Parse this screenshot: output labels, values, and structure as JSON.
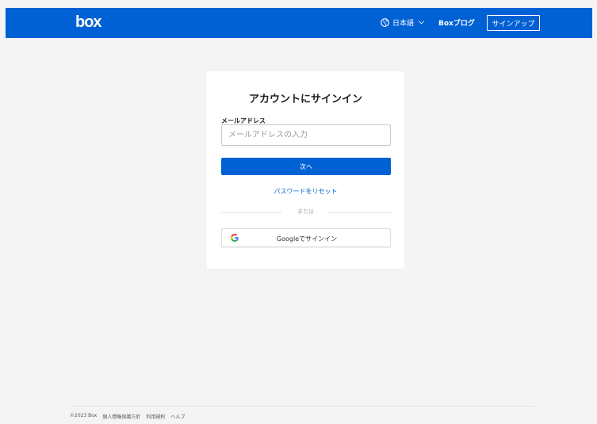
{
  "header": {
    "logo": "box",
    "language": "日本語",
    "blog": "Boxブログ",
    "signup": "サインアップ",
    "bg_color": "#0061d5"
  },
  "signin": {
    "title": "アカウントにサインイン",
    "email_label": "メールアドレス",
    "email_placeholder": "メールアドレスの入力",
    "email_value": "",
    "next_button": "次へ",
    "reset_link": "パスワードをリセット",
    "or_text": "または",
    "google_button": "Googleでサインイン"
  },
  "footer": {
    "copyright": "©2023 Box",
    "privacy": "個人情報保護方針",
    "terms": "利用規約",
    "help": "ヘルプ"
  },
  "icons": {
    "language": "globe-icon",
    "dropdown": "chevron-down-icon",
    "google": "google-icon"
  }
}
